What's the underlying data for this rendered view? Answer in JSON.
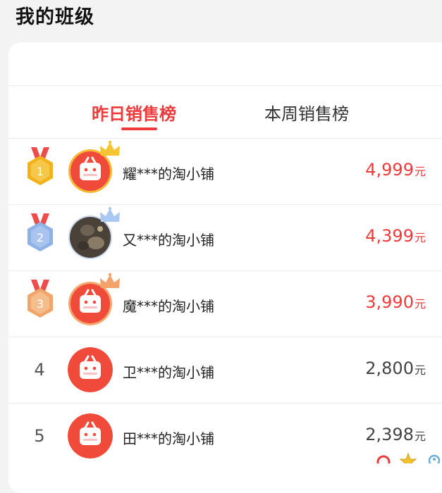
{
  "page": {
    "title": "我的班级"
  },
  "tabs": [
    {
      "label": "昨日销售榜",
      "active": true
    },
    {
      "label": "本周销售榜",
      "active": false
    }
  ],
  "colors": {
    "accent": "#ee3a3a",
    "gold": "#f2b21b",
    "silver": "#8fb2e6",
    "bronze": "#f0a66b"
  },
  "ranking": [
    {
      "rank": "1",
      "medal": "gold",
      "avatar": "store-logo-icon",
      "crown": "crown-icon",
      "name": "耀***的淘小铺",
      "amount": "4,999",
      "unit": "元"
    },
    {
      "rank": "2",
      "medal": "silver",
      "avatar": "user-photo",
      "crown": "crown-icon",
      "name": "又***的淘小铺",
      "amount": "4,399",
      "unit": "元"
    },
    {
      "rank": "3",
      "medal": "bronze",
      "avatar": "store-logo-icon",
      "crown": "crown-icon",
      "name": "魔***的淘小铺",
      "amount": "3,990",
      "unit": "元"
    },
    {
      "rank": "4",
      "medal": "",
      "avatar": "store-logo-icon",
      "crown": "",
      "name": "卫***的淘小铺",
      "amount": "2,800",
      "unit": "元"
    },
    {
      "rank": "5",
      "medal": "",
      "avatar": "store-logo-icon",
      "crown": "",
      "name": "田***的淘小铺",
      "amount": "2,398",
      "unit": "元"
    }
  ]
}
